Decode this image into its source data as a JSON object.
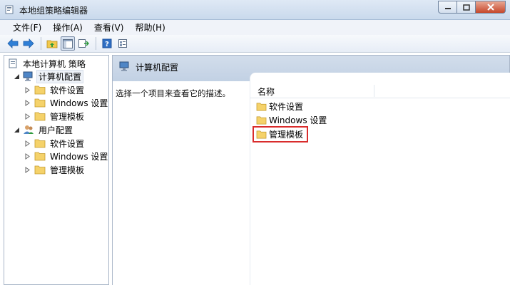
{
  "window": {
    "title": "本地组策略编辑器"
  },
  "menu": [
    "文件(F)",
    "操作(A)",
    "查看(V)",
    "帮助(H)"
  ],
  "toolbar": {
    "buttons": [
      "back-arrow-icon",
      "forward-arrow-icon",
      "up-folder-icon",
      "show-hide-tree-icon",
      "export-list-icon",
      "help-icon",
      "properties-icon"
    ]
  },
  "tree": {
    "root": "本地计算机 策略",
    "computer": {
      "label": "计算机配置",
      "children": [
        "软件设置",
        "Windows 设置",
        "管理模板"
      ]
    },
    "user": {
      "label": "用户配置",
      "children": [
        "软件设置",
        "Windows 设置",
        "管理模板"
      ]
    }
  },
  "right": {
    "header": "计算机配置",
    "description": "选择一个项目来查看它的描述。",
    "column_name": "名称",
    "items": [
      "软件设置",
      "Windows 设置",
      "管理模板"
    ]
  },
  "colors": {
    "folder": "#f2c94c",
    "highlight_border": "#d92c2c",
    "title_bar": "#c9d9ec"
  }
}
